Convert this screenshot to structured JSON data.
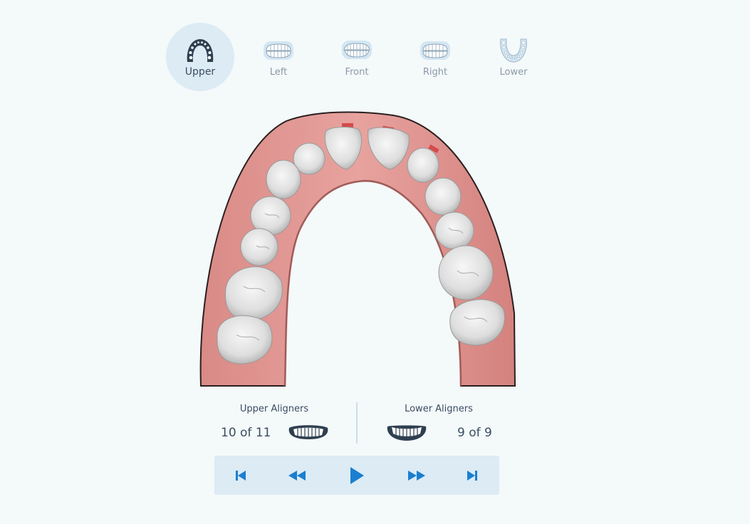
{
  "views": {
    "tabs": [
      {
        "label": "Upper",
        "icon": "upper-arch-icon",
        "active": true
      },
      {
        "label": "Left",
        "icon": "left-teeth-icon",
        "active": false
      },
      {
        "label": "Front",
        "icon": "front-teeth-icon",
        "active": false
      },
      {
        "label": "Right",
        "icon": "right-teeth-icon",
        "active": false
      },
      {
        "label": "Lower",
        "icon": "lower-arch-icon",
        "active": false
      }
    ]
  },
  "aligners": {
    "upper": {
      "title": "Upper Aligners",
      "count": "10 of 11",
      "icon": "upper-aligner-icon"
    },
    "lower": {
      "title": "Lower Aligners",
      "count": "9 of 9",
      "icon": "lower-aligner-icon"
    }
  },
  "player": {
    "controls": [
      "skip-to-start-icon",
      "rewind-icon",
      "play-icon",
      "fast-forward-icon",
      "skip-to-end-icon"
    ]
  },
  "colors": {
    "background": "#f4f9fa",
    "accent": "#1a7fd0",
    "active_tab_bg": "#dcebf4",
    "text_dark": "#3b4d61",
    "text_muted": "#8b99a8",
    "gum": "#e29a96",
    "tooth": "#e6e6e6"
  }
}
